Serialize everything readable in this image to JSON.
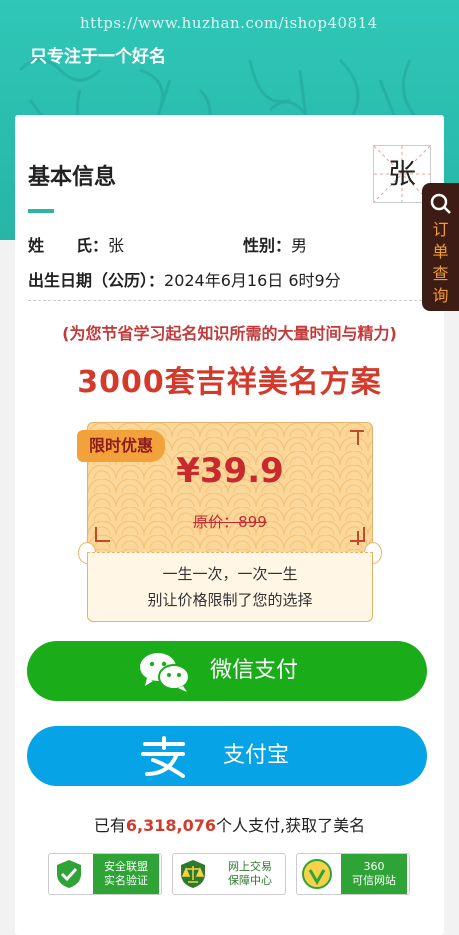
{
  "header": {
    "url_watermark": "https://www.huzhan.com/ishop40814",
    "tagline": "只专注于一个好名"
  },
  "basic_info": {
    "title": "基本信息",
    "surname_char": "张",
    "surname_label": "姓　　氏：",
    "surname_value": "张",
    "gender_label": "性别：",
    "gender_value": "男",
    "birth_label": "出生日期（公历）：",
    "birth_value": "2024年6月16日 6时9分"
  },
  "offer": {
    "subtitle": "(为您节省学习起名知识所需的大量时间与精力)",
    "headline": "3000套吉祥美名方案",
    "badge": "限时优惠",
    "price": "¥39.9",
    "original_price": "原价：899",
    "line1": "一生一次，一次一生",
    "line2": "别让价格限制了您的选择"
  },
  "payment": {
    "wechat_label": "微信支付",
    "alipay_label": "支付宝",
    "wechat_color": "#1aad19",
    "alipay_color": "#06a3e6"
  },
  "stats": {
    "prefix": "已有",
    "count": "6,318,076",
    "suffix": "个人支付,获取了美名"
  },
  "trust_badges": [
    {
      "line1": "安全联盟",
      "line2": "实名验证",
      "icon": "shield-check-icon"
    },
    {
      "line1": "网上交易",
      "line2": "保障中心",
      "icon": "scales-icon"
    },
    {
      "line1": "360",
      "line2": "可信网站",
      "icon": "360-check-icon"
    }
  ],
  "side_tab": {
    "label": "订单查询",
    "icon": "search-icon"
  }
}
